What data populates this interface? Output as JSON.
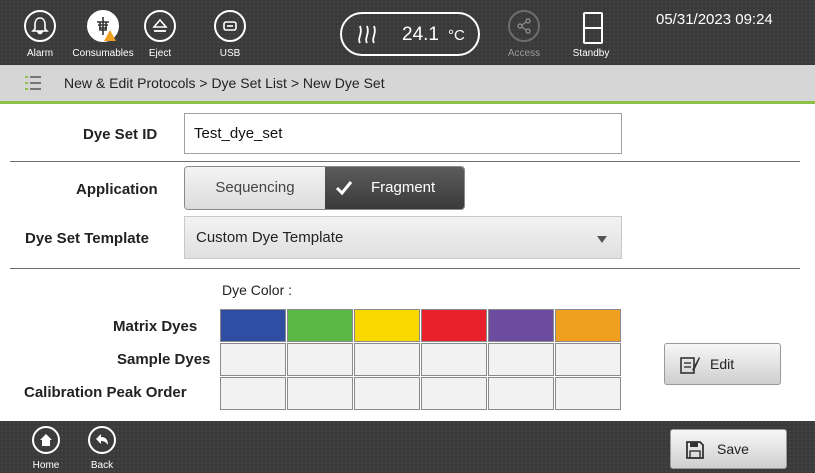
{
  "topbar": {
    "alarm_label": "Alarm",
    "consumables_label": "Consumables",
    "eject_label": "Eject",
    "usb_label": "USB",
    "temperature_value": "24.1",
    "temperature_unit": "°C",
    "access_label": "Access",
    "standby_label": "Standby",
    "datetime": "05/31/2023 09:24"
  },
  "breadcrumb": {
    "text": "New & Edit Protocols > Dye Set List > New Dye Set"
  },
  "form": {
    "dye_set_id_label": "Dye Set ID",
    "dye_set_id_value": "Test_dye_set",
    "application_label": "Application",
    "application_options": [
      "Sequencing",
      "Fragment"
    ],
    "application_selected": "Fragment",
    "template_label": "Dye Set Template",
    "template_value": "Custom Dye Template",
    "dye_color_label": "Dye Color :",
    "matrix_dyes_label": "Matrix Dyes",
    "sample_dyes_label": "Sample Dyes",
    "calibration_label": "Calibration Peak Order",
    "matrix_dye_colors": [
      "#2e4da3",
      "#5bb844",
      "#f9d800",
      "#e8212b",
      "#6b4c9e",
      "#f0a01e"
    ],
    "edit_label": "Edit"
  },
  "bottombar": {
    "home_label": "Home",
    "back_label": "Back",
    "save_label": "Save"
  },
  "colors": {
    "accent_green": "#8cc047",
    "bar_dark": "#3a3a3a"
  }
}
